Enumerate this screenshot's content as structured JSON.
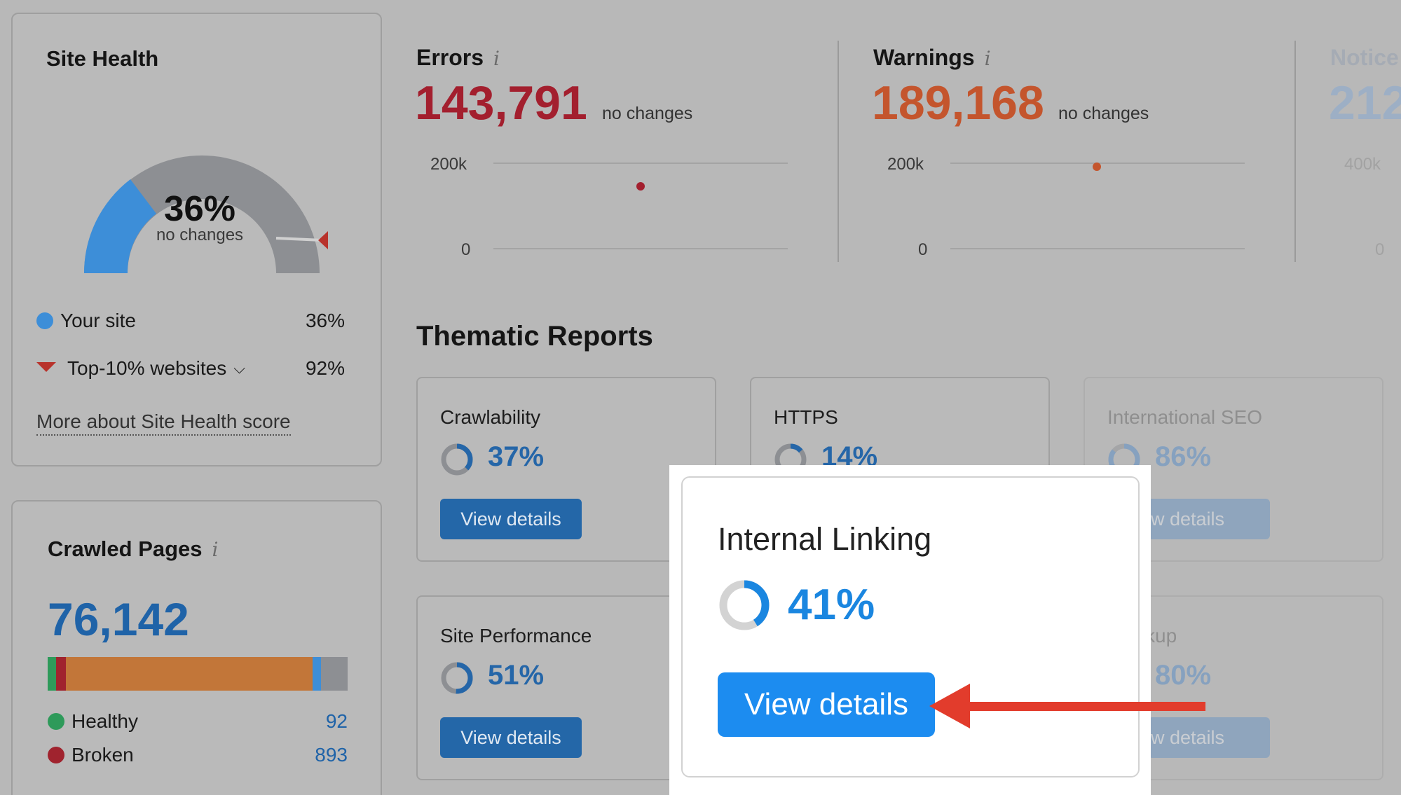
{
  "site_health": {
    "title": "Site Health",
    "percent": "36%",
    "change": "no changes",
    "gauge_fraction": 0.36,
    "benchmark_fraction": 0.92,
    "legend": [
      {
        "label": "Your site",
        "value": "36%"
      },
      {
        "label": "Top-10% websites",
        "value": "92%"
      }
    ],
    "more_link": "More about Site Health score"
  },
  "crawled_pages": {
    "title": "Crawled Pages",
    "total": "76,142",
    "rows": [
      {
        "label": "Healthy",
        "value": "92"
      },
      {
        "label": "Broken",
        "value": "893"
      }
    ]
  },
  "errors": {
    "title": "Errors",
    "value": "143,791",
    "change": "no changes",
    "axis_top": "200k",
    "axis_bottom": "0"
  },
  "warnings": {
    "title": "Warnings",
    "value": "189,168",
    "change": "no changes",
    "axis_top": "200k",
    "axis_bottom": "0"
  },
  "notices": {
    "title": "Notice",
    "value": "212",
    "axis_top": "400k",
    "axis_bottom": "0"
  },
  "thematic": {
    "title": "Thematic Reports",
    "button_label": "View details",
    "partial_button_label": "w details",
    "reports": [
      {
        "name": "Crawlability",
        "percent": "37%"
      },
      {
        "name": "HTTPS",
        "percent": "14%"
      },
      {
        "name": "International SEO",
        "percent": "86%"
      },
      {
        "name": "Site Performance",
        "percent": "51%"
      },
      {
        "name": "kup",
        "percent": "80%"
      }
    ]
  },
  "highlight": {
    "name": "Internal Linking",
    "percent": "41%",
    "button_label": "View details"
  },
  "colors": {
    "your_site": "#3d8ed8",
    "benchmark": "#b8332c",
    "errors": "#a31f2e",
    "warnings": "#c4552d",
    "primary_button": "#1c8cf0",
    "arrow": "#e23c2c",
    "healthy": "#2e9a5a",
    "broken": "#a0232e"
  }
}
